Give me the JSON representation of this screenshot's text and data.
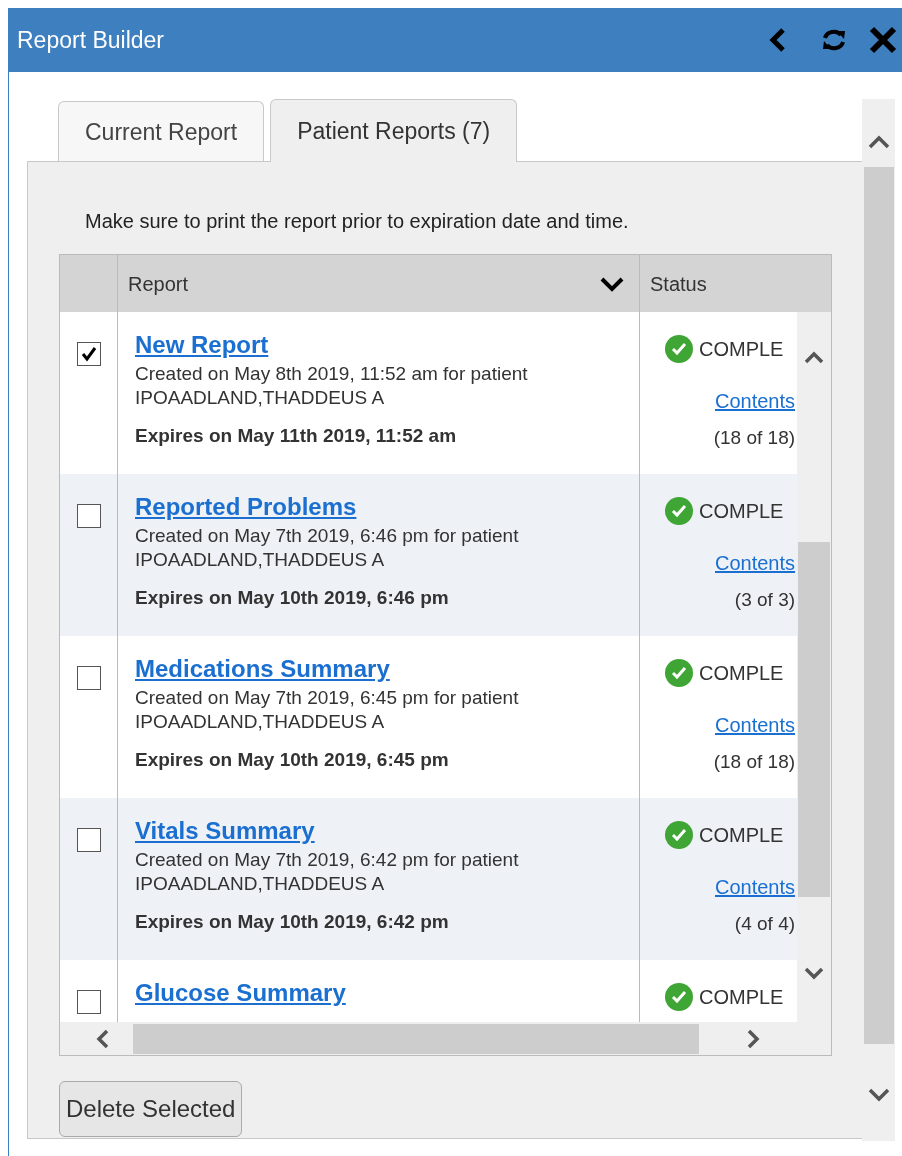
{
  "window": {
    "title": "Report Builder"
  },
  "tabs": [
    {
      "label": "Current Report",
      "selected": false
    },
    {
      "label": "Patient Reports (7)",
      "selected": true
    }
  ],
  "notice": "Make sure to print the report prior to expiration date and time.",
  "table": {
    "columns": [
      "Report",
      "Status"
    ],
    "rows": [
      {
        "checked": true,
        "title": "New Report",
        "created": "Created on May 8th 2019, 11:52 am for patient",
        "patient": "IPOAADLAND,THADDEUS A",
        "expires": "Expires on May 11th 2019, 11:52 am",
        "status": "COMPLE",
        "contents": "Contents",
        "count": "(18 of 18)"
      },
      {
        "checked": false,
        "title": "Reported Problems",
        "created": "Created on May 7th 2019, 6:46 pm for patient",
        "patient": "IPOAADLAND,THADDEUS A",
        "expires": "Expires on May 10th 2019, 6:46 pm",
        "status": "COMPLE",
        "contents": "Contents",
        "count": "(3 of 3)"
      },
      {
        "checked": false,
        "title": "Medications Summary",
        "created": "Created on May 7th 2019, 6:45 pm for patient",
        "patient": "IPOAADLAND,THADDEUS A",
        "expires": "Expires on May 10th 2019, 6:45 pm",
        "status": "COMPLE",
        "contents": "Contents",
        "count": "(18 of 18)"
      },
      {
        "checked": false,
        "title": "Vitals Summary",
        "created": "Created on May 7th 2019, 6:42 pm for patient",
        "patient": "IPOAADLAND,THADDEUS A",
        "expires": "Expires on May 10th 2019, 6:42 pm",
        "status": "COMPLE",
        "contents": "Contents",
        "count": "(4 of 4)"
      },
      {
        "checked": false,
        "title": "Glucose Summary",
        "status": "COMPLE"
      }
    ]
  },
  "buttons": [
    "Delete Selected"
  ]
}
